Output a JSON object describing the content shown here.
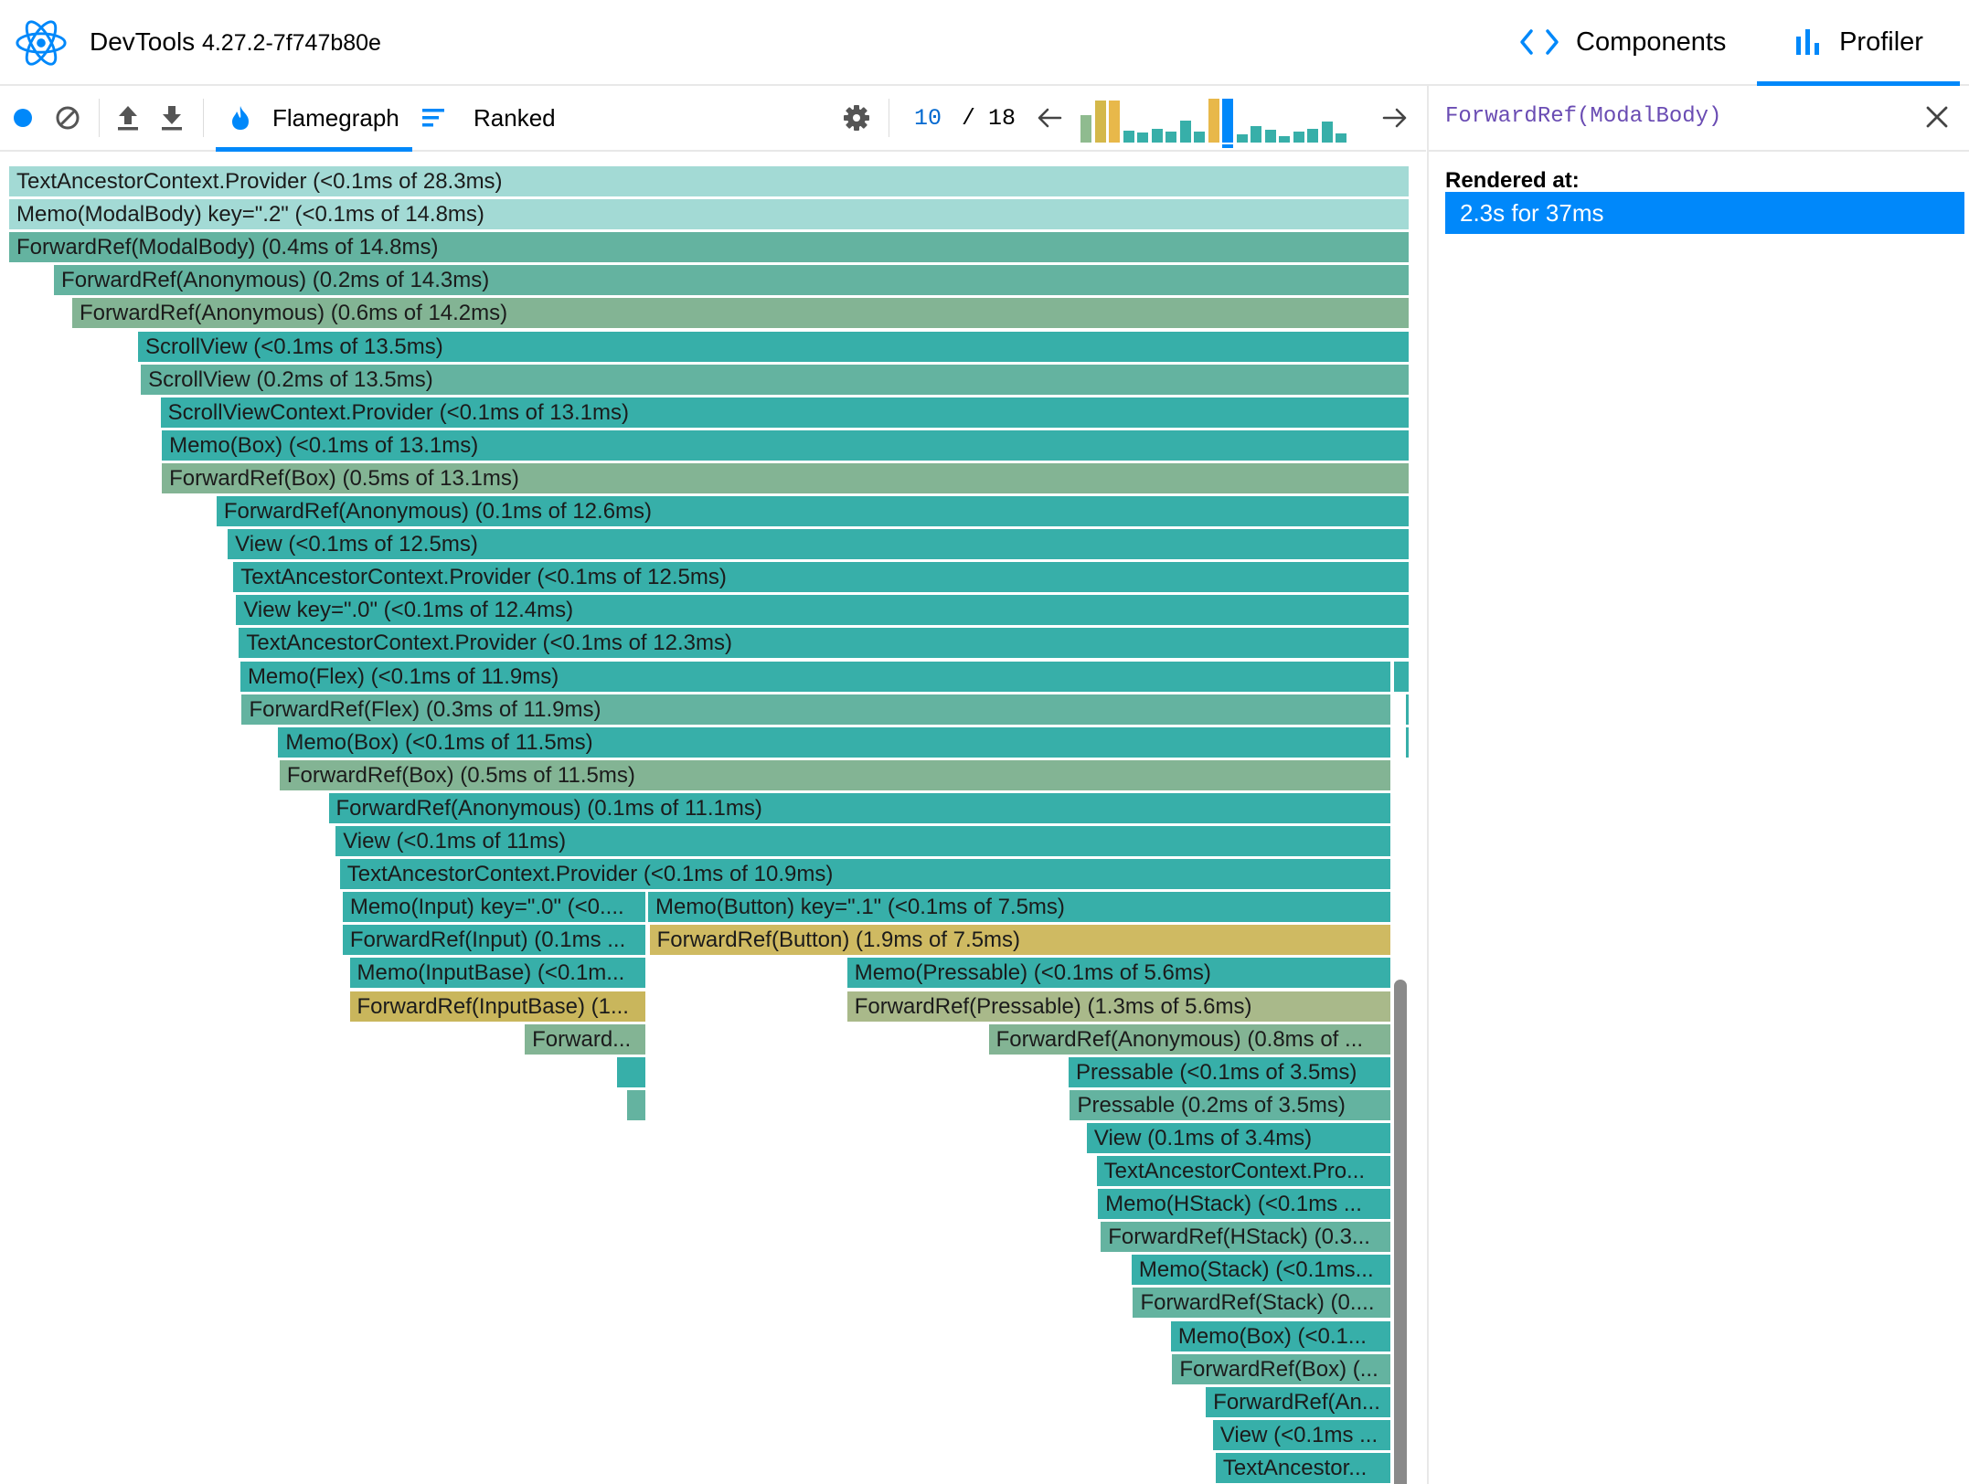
{
  "header": {
    "app_name": "DevTools",
    "version": "4.27.2-7f747b80e",
    "tabs": [
      {
        "label": "Components",
        "active": false
      },
      {
        "label": "Profiler",
        "active": true
      }
    ]
  },
  "toolbar": {
    "views": [
      {
        "label": "Flamegraph",
        "active": true
      },
      {
        "label": "Ranked",
        "active": false
      }
    ],
    "commit_current": "10",
    "commit_separator": "/",
    "commit_total": "18",
    "commit_bars": [
      {
        "value": 0.62,
        "color": "#8fbb8f"
      },
      {
        "value": 0.95,
        "color": "#d4b84a"
      },
      {
        "value": 0.95,
        "color": "#e8b84a"
      },
      {
        "value": 0.28,
        "color": "#37afa9"
      },
      {
        "value": 0.22,
        "color": "#37afa9"
      },
      {
        "value": 0.32,
        "color": "#37afa9"
      },
      {
        "value": 0.25,
        "color": "#37afa9"
      },
      {
        "value": 0.5,
        "color": "#37afa9"
      },
      {
        "value": 0.25,
        "color": "#37afa9"
      },
      {
        "value": 1.0,
        "color": "#e8b84a",
        "selected": false
      },
      {
        "value": 1.0,
        "color": "#0088fa",
        "selected": true
      },
      {
        "value": 0.18,
        "color": "#37afa9"
      },
      {
        "value": 0.38,
        "color": "#37afa9"
      },
      {
        "value": 0.3,
        "color": "#37afa9"
      },
      {
        "value": 0.15,
        "color": "#37afa9"
      },
      {
        "value": 0.25,
        "color": "#37afa9"
      },
      {
        "value": 0.32,
        "color": "#37afa9"
      },
      {
        "value": 0.48,
        "color": "#37afa9"
      },
      {
        "value": 0.2,
        "color": "#37afa9"
      }
    ]
  },
  "side_panel": {
    "title": "ForwardRef(ModalBody)",
    "rendered_at_label": "Rendered at:",
    "render_entries": [
      "2.3s for 37ms"
    ]
  },
  "colors": {
    "accent": "#0088fa",
    "teal": "#37afa9",
    "teal_light": "#a3dad5",
    "teal_mid": "#64b3a0",
    "sage": "#83b494",
    "olive": "#a9b98a",
    "gold": "#cfba62",
    "mustard": "#c9b65c"
  },
  "flamegraph": {
    "rows": [
      [
        {
          "label": "TextAncestorContext.Provider (<0.1ms of 28.3ms)",
          "start": 0.0,
          "end": 1.0,
          "color": "#a3dad5"
        }
      ],
      [
        {
          "label": "Memo(ModalBody) key=\".2\" (<0.1ms of 14.8ms)",
          "start": 0.0,
          "end": 1.0,
          "color": "#a3dad5"
        }
      ],
      [
        {
          "label": "ForwardRef(ModalBody) (0.4ms of 14.8ms)",
          "start": 0.0,
          "end": 1.0,
          "color": "#64b3a0"
        }
      ],
      [
        {
          "label": "ForwardRef(Anonymous) (0.2ms of 14.3ms)",
          "start": 0.032,
          "end": 1.0,
          "color": "#64b3a0"
        }
      ],
      [
        {
          "label": "ForwardRef(Anonymous) (0.6ms of 14.2ms)",
          "start": 0.045,
          "end": 1.0,
          "color": "#83b494"
        }
      ],
      [
        {
          "label": "ScrollView (<0.1ms of 13.5ms)",
          "start": 0.092,
          "end": 1.0,
          "color": "#37afa9"
        }
      ],
      [
        {
          "label": "ScrollView (0.2ms of 13.5ms)",
          "start": 0.094,
          "end": 1.0,
          "color": "#64b3a0"
        }
      ],
      [
        {
          "label": "ScrollViewContext.Provider (<0.1ms of 13.1ms)",
          "start": 0.108,
          "end": 1.0,
          "color": "#37afa9"
        }
      ],
      [
        {
          "label": "Memo(Box) (<0.1ms of 13.1ms)",
          "start": 0.109,
          "end": 1.0,
          "color": "#37afa9"
        }
      ],
      [
        {
          "label": "ForwardRef(Box) (0.5ms of 13.1ms)",
          "start": 0.109,
          "end": 1.0,
          "color": "#83b494"
        }
      ],
      [
        {
          "label": "ForwardRef(Anonymous) (0.1ms of 12.6ms)",
          "start": 0.148,
          "end": 1.0,
          "color": "#37afa9"
        }
      ],
      [
        {
          "label": "View (<0.1ms of 12.5ms)",
          "start": 0.156,
          "end": 1.0,
          "color": "#37afa9"
        }
      ],
      [
        {
          "label": "TextAncestorContext.Provider (<0.1ms of 12.5ms)",
          "start": 0.16,
          "end": 1.0,
          "color": "#37afa9"
        }
      ],
      [
        {
          "label": "View key=\".0\" (<0.1ms of 12.4ms)",
          "start": 0.162,
          "end": 1.0,
          "color": "#37afa9"
        }
      ],
      [
        {
          "label": "TextAncestorContext.Provider (<0.1ms of 12.3ms)",
          "start": 0.164,
          "end": 1.0,
          "color": "#37afa9"
        }
      ],
      [
        {
          "label": "Memo(Flex) (<0.1ms of 11.9ms)",
          "start": 0.165,
          "end": 0.987,
          "color": "#37afa9"
        },
        {
          "label": "",
          "start": 0.988,
          "end": 1.0,
          "color": "#37afa9"
        }
      ],
      [
        {
          "label": "ForwardRef(Flex) (0.3ms of 11.9ms)",
          "start": 0.166,
          "end": 0.987,
          "color": "#64b3a0"
        },
        {
          "label": "",
          "start": 0.997,
          "end": 1.0,
          "color": "#37afa9"
        }
      ],
      [
        {
          "label": "Memo(Box) (<0.1ms of 11.5ms)",
          "start": 0.192,
          "end": 0.987,
          "color": "#37afa9"
        },
        {
          "label": "",
          "start": 0.997,
          "end": 1.0,
          "color": "#37afa9"
        }
      ],
      [
        {
          "label": "ForwardRef(Box) (0.5ms of 11.5ms)",
          "start": 0.193,
          "end": 0.987,
          "color": "#83b494"
        }
      ],
      [
        {
          "label": "ForwardRef(Anonymous) (0.1ms of 11.1ms)",
          "start": 0.228,
          "end": 0.987,
          "color": "#37afa9"
        }
      ],
      [
        {
          "label": "View (<0.1ms of 11ms)",
          "start": 0.233,
          "end": 0.987,
          "color": "#37afa9"
        }
      ],
      [
        {
          "label": "TextAncestorContext.Provider (<0.1ms of 10.9ms)",
          "start": 0.236,
          "end": 0.987,
          "color": "#37afa9"
        }
      ],
      [
        {
          "label": "Memo(Input) key=\".0\" (<0....",
          "start": 0.238,
          "end": 0.455,
          "color": "#37afa9"
        },
        {
          "label": "Memo(Button) key=\".1\" (<0.1ms of 7.5ms)",
          "start": 0.456,
          "end": 0.987,
          "color": "#37afa9"
        }
      ],
      [
        {
          "label": "ForwardRef(Input) (0.1ms ...",
          "start": 0.238,
          "end": 0.455,
          "color": "#37afa9"
        },
        {
          "label": "ForwardRef(Button) (1.9ms of 7.5ms)",
          "start": 0.457,
          "end": 0.987,
          "color": "#cfba62"
        }
      ],
      [
        {
          "label": "Memo(InputBase) (<0.1m...",
          "start": 0.243,
          "end": 0.455,
          "color": "#37afa9"
        },
        {
          "label": "Memo(Pressable) (<0.1ms of 5.6ms)",
          "start": 0.598,
          "end": 0.987,
          "color": "#37afa9"
        }
      ],
      [
        {
          "label": "ForwardRef(InputBase) (1...",
          "start": 0.243,
          "end": 0.455,
          "color": "#c9b65c"
        },
        {
          "label": "ForwardRef(Pressable) (1.3ms of 5.6ms)",
          "start": 0.598,
          "end": 0.987,
          "color": "#a9b98a"
        }
      ],
      [
        {
          "label": "Forward...",
          "start": 0.368,
          "end": 0.455,
          "color": "#83b494"
        },
        {
          "label": "ForwardRef(Anonymous) (0.8ms of ...",
          "start": 0.699,
          "end": 0.987,
          "color": "#83b494"
        }
      ],
      [
        {
          "label": "",
          "start": 0.434,
          "end": 0.455,
          "color": "#37afa9"
        },
        {
          "label": "Pressable (<0.1ms of 3.5ms)",
          "start": 0.756,
          "end": 0.987,
          "color": "#37afa9"
        }
      ],
      [
        {
          "label": "",
          "start": 0.441,
          "end": 0.455,
          "color": "#64b3a0"
        },
        {
          "label": "Pressable (0.2ms of 3.5ms)",
          "start": 0.757,
          "end": 0.987,
          "color": "#64b3a0"
        }
      ],
      [
        {
          "label": "View (0.1ms of 3.4ms)",
          "start": 0.769,
          "end": 0.987,
          "color": "#37afa9"
        }
      ],
      [
        {
          "label": "TextAncestorContext.Pro...",
          "start": 0.776,
          "end": 0.987,
          "color": "#37afa9"
        }
      ],
      [
        {
          "label": "Memo(HStack) (<0.1ms ...",
          "start": 0.777,
          "end": 0.987,
          "color": "#37afa9"
        }
      ],
      [
        {
          "label": "ForwardRef(HStack) (0.3...",
          "start": 0.779,
          "end": 0.987,
          "color": "#64b3a0"
        }
      ],
      [
        {
          "label": "Memo(Stack) (<0.1ms...",
          "start": 0.801,
          "end": 0.987,
          "color": "#37afa9"
        }
      ],
      [
        {
          "label": "ForwardRef(Stack) (0....",
          "start": 0.802,
          "end": 0.987,
          "color": "#64b3a0"
        }
      ],
      [
        {
          "label": "Memo(Box) (<0.1...",
          "start": 0.829,
          "end": 0.987,
          "color": "#37afa9"
        }
      ],
      [
        {
          "label": "ForwardRef(Box) (...",
          "start": 0.83,
          "end": 0.987,
          "color": "#64b3a0"
        }
      ],
      [
        {
          "label": "ForwardRef(An...",
          "start": 0.854,
          "end": 0.987,
          "color": "#37afa9"
        }
      ],
      [
        {
          "label": "View (<0.1ms ...",
          "start": 0.859,
          "end": 0.987,
          "color": "#37afa9"
        }
      ],
      [
        {
          "label": "TextAncestor...",
          "start": 0.861,
          "end": 0.987,
          "color": "#37afa9"
        }
      ]
    ]
  }
}
